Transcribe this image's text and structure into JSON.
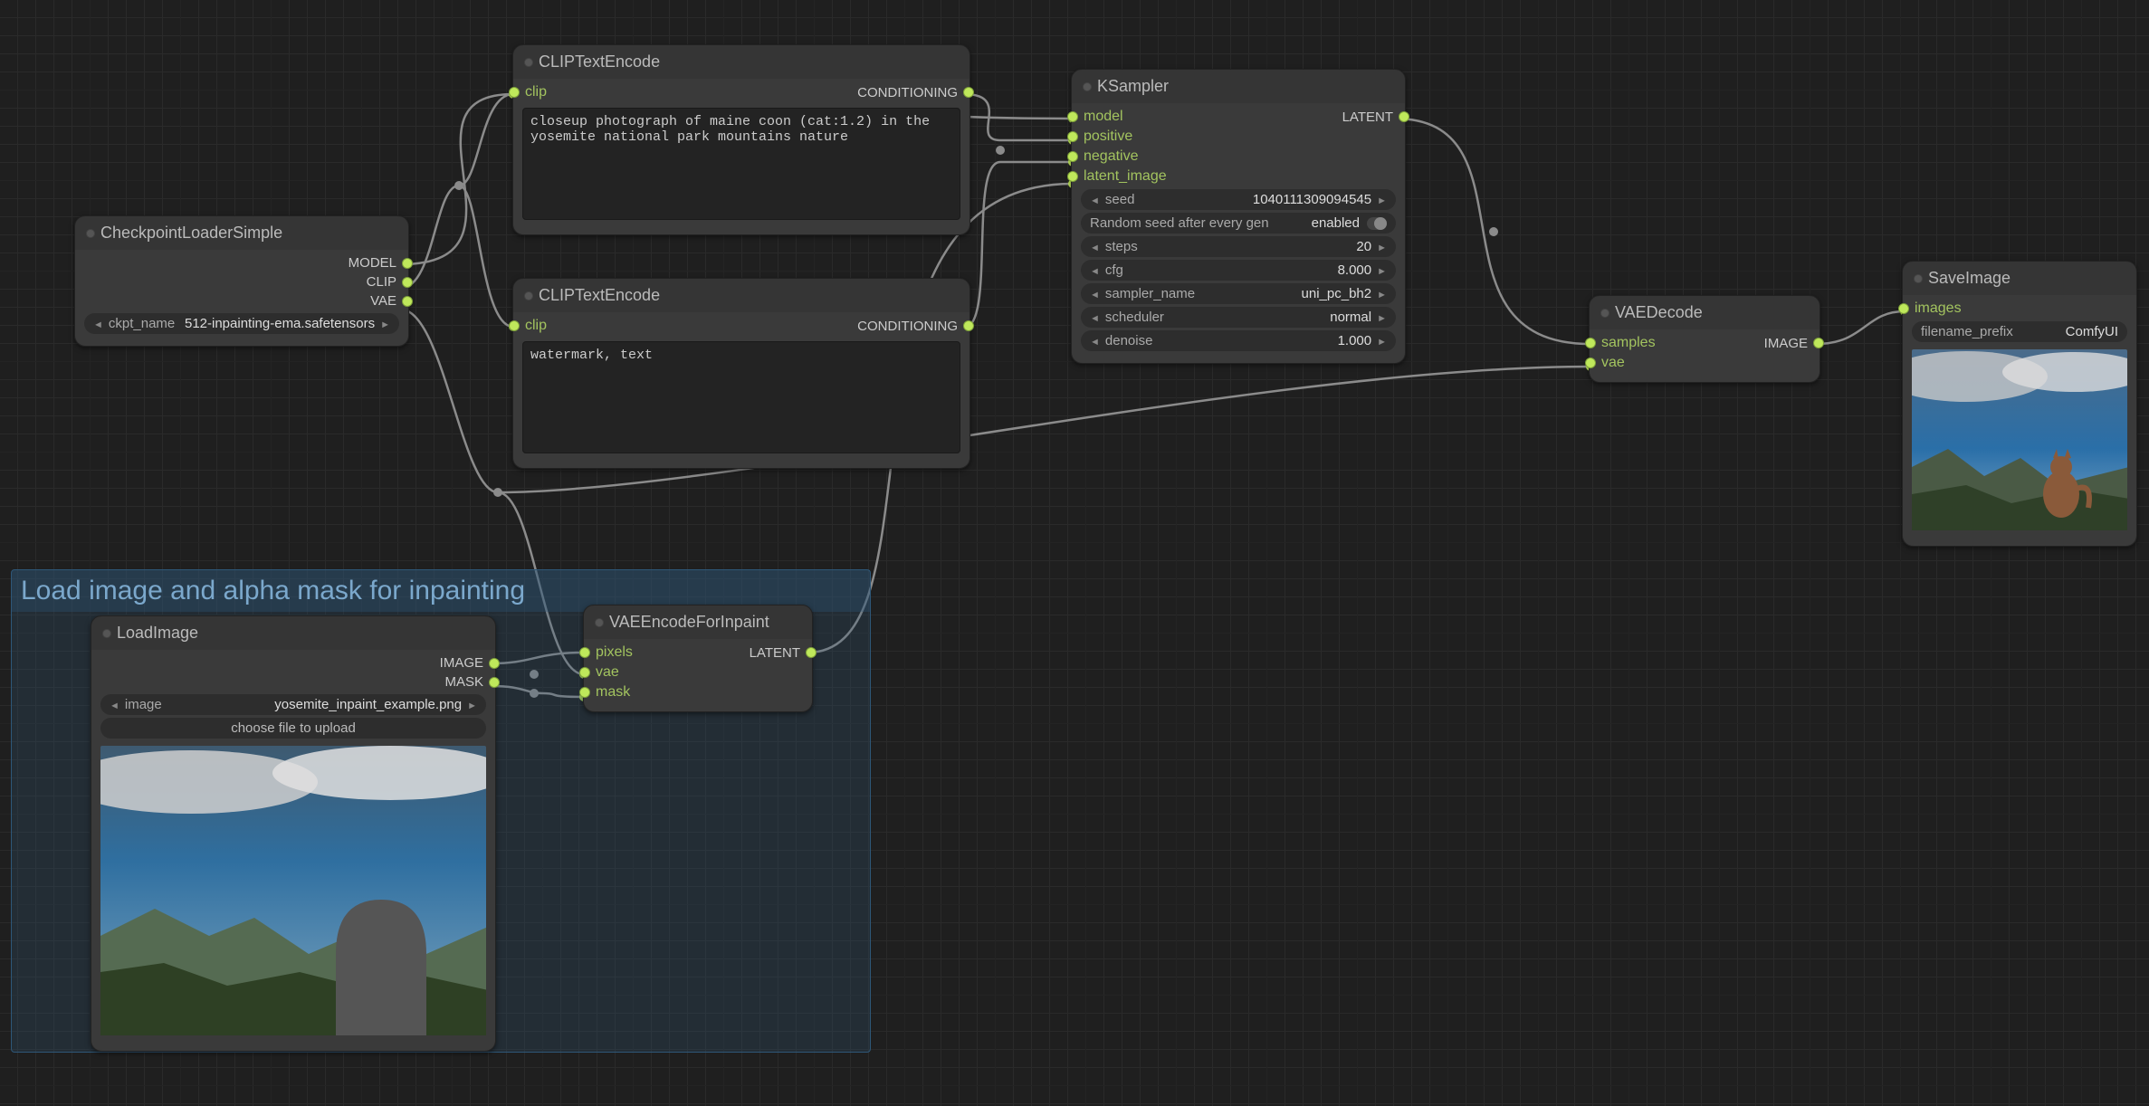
{
  "group": {
    "title": "Load image and alpha mask for inpainting"
  },
  "nodes": {
    "ckpt": {
      "title": "CheckpointLoaderSimple",
      "out_model": "MODEL",
      "out_clip": "CLIP",
      "out_vae": "VAE",
      "ckpt_name_label": "ckpt_name",
      "ckpt_name_value": "512-inpainting-ema.safetensors"
    },
    "cliptext1": {
      "title": "CLIPTextEncode",
      "in_clip": "clip",
      "out_cond": "CONDITIONING",
      "text": "closeup photograph of maine coon (cat:1.2) in the yosemite national park mountains nature"
    },
    "cliptext2": {
      "title": "CLIPTextEncode",
      "in_clip": "clip",
      "out_cond": "CONDITIONING",
      "text": "watermark, text"
    },
    "ksampler": {
      "title": "KSampler",
      "in_model": "model",
      "in_positive": "positive",
      "in_negative": "negative",
      "in_latent": "latent_image",
      "out_latent": "LATENT",
      "seed_label": "seed",
      "seed_value": "1040111309094545",
      "random_label": "Random seed after every gen",
      "random_value": "enabled",
      "steps_label": "steps",
      "steps_value": "20",
      "cfg_label": "cfg",
      "cfg_value": "8.000",
      "sampler_label": "sampler_name",
      "sampler_value": "uni_pc_bh2",
      "scheduler_label": "scheduler",
      "scheduler_value": "normal",
      "denoise_label": "denoise",
      "denoise_value": "1.000"
    },
    "vaedecode": {
      "title": "VAEDecode",
      "in_samples": "samples",
      "in_vae": "vae",
      "out_image": "IMAGE"
    },
    "saveimage": {
      "title": "SaveImage",
      "in_images": "images",
      "prefix_label": "filename_prefix",
      "prefix_value": "ComfyUI"
    },
    "loadimage": {
      "title": "LoadImage",
      "out_image": "IMAGE",
      "out_mask": "MASK",
      "image_label": "image",
      "image_value": "yosemite_inpaint_example.png",
      "upload_label": "choose file to upload"
    },
    "vaeinpaint": {
      "title": "VAEEncodeForInpaint",
      "in_pixels": "pixels",
      "in_vae": "vae",
      "in_mask": "mask",
      "out_latent": "LATENT"
    }
  }
}
